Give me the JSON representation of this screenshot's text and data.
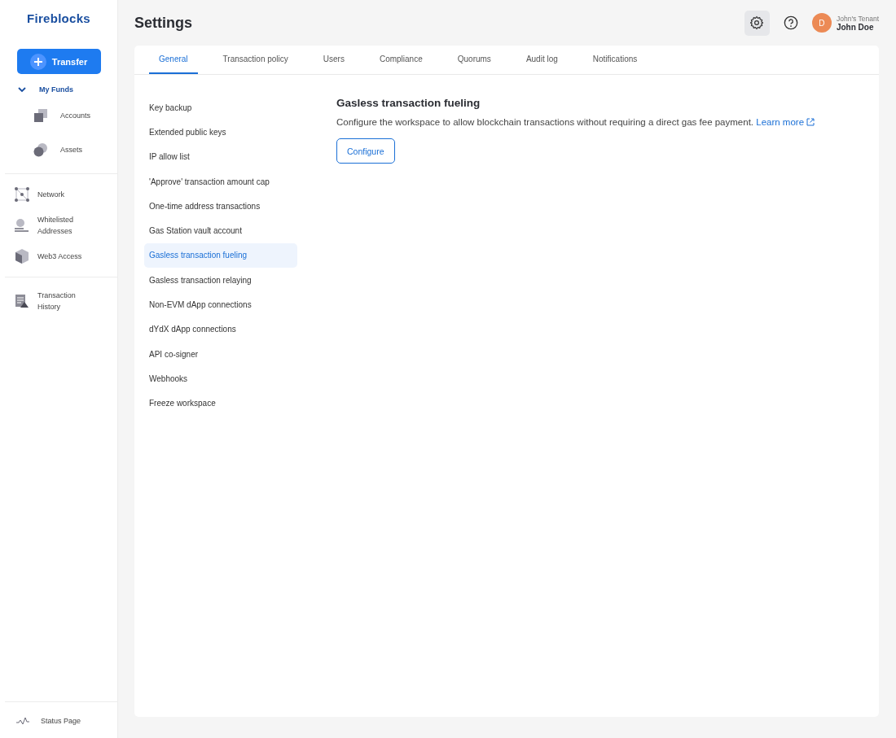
{
  "sidebar": {
    "logo": "Fireblocks",
    "transfer_button": "Transfer",
    "sections": [
      {
        "items": [
          {
            "label": "My Funds",
            "kind": "group",
            "expanded": true,
            "children": [
              {
                "label": "Accounts",
                "kind": "accounts"
              },
              {
                "label": "Assets",
                "kind": "assets"
              }
            ]
          }
        ]
      },
      {
        "items": [
          {
            "label": "Network",
            "kind": "network"
          },
          {
            "label": "Whitelisted Addresses",
            "kind": "whitelist"
          },
          {
            "label": "Web3 Access",
            "kind": "web3"
          }
        ]
      },
      {
        "items": [
          {
            "label": "Transaction History",
            "kind": "history"
          }
        ]
      }
    ],
    "footer": {
      "label": "Status Page"
    }
  },
  "header": {
    "title": "Settings",
    "user": {
      "initial": "D",
      "tenant": "John's Tenant",
      "name": "John Doe"
    }
  },
  "tabs": [
    {
      "label": "General",
      "selected": true
    },
    {
      "label": "Transaction policy",
      "selected": false
    },
    {
      "label": "Users",
      "selected": false
    },
    {
      "label": "Compliance",
      "selected": false
    },
    {
      "label": "Quorums",
      "selected": false
    },
    {
      "label": "Audit log",
      "selected": false
    },
    {
      "label": "Notifications",
      "selected": false
    }
  ],
  "menu": [
    {
      "label": "Key backup",
      "selected": false
    },
    {
      "label": "Extended public keys",
      "selected": false
    },
    {
      "label": "IP allow list",
      "selected": false
    },
    {
      "label": "'Approve' transaction amount cap",
      "selected": false
    },
    {
      "label": "One-time address transactions",
      "selected": false
    },
    {
      "label": "Gas Station vault account",
      "selected": false
    },
    {
      "label": "Gasless transaction fueling",
      "selected": true
    },
    {
      "label": "Gasless transaction relaying",
      "selected": false
    },
    {
      "label": "Non-EVM dApp connections",
      "selected": false
    },
    {
      "label": "dYdX dApp connections",
      "selected": false
    },
    {
      "label": "API co-signer",
      "selected": false
    },
    {
      "label": "Webhooks",
      "selected": false
    },
    {
      "label": "Freeze workspace",
      "selected": false
    }
  ],
  "content": {
    "heading": "Gasless transaction fueling",
    "description": "Configure the workspace to allow blockchain transactions without requiring a direct gas fee payment.",
    "link": "Learn more",
    "button": "Configure"
  }
}
